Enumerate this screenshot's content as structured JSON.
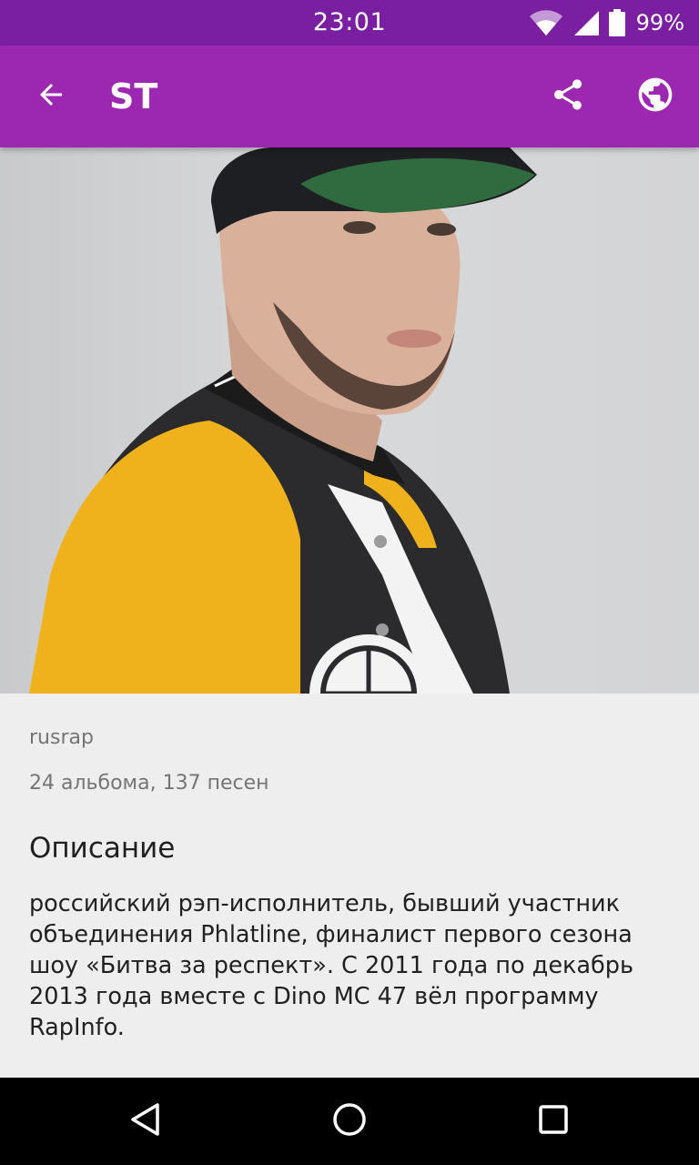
{
  "status_bar": {
    "time": "23:01",
    "battery": "99%",
    "icons": [
      "wifi-icon",
      "signal-icon",
      "battery-icon"
    ]
  },
  "app_bar": {
    "title": "ST",
    "icons": [
      "back-arrow-icon",
      "share-icon",
      "globe-icon"
    ]
  },
  "artist": {
    "genre": "rusrap",
    "counts": "24 альбома, 137 песен",
    "description_heading": "Описание",
    "description": "российский рэп-исполнитель, бывший участник объединения Phlatline, финалист первого сезона шоу «Битва за респект». С 2011 года по декабрь 2013 года вместе с Dino MC 47 вёл программу RapInfo."
  },
  "nav_bar": {
    "icons": [
      "back-triangle-icon",
      "home-circle-icon",
      "recents-square-icon"
    ]
  },
  "colors": {
    "status_bar": "#7b1fa2",
    "app_bar": "#9c27b0",
    "background": "#eeeeee",
    "nav_bar": "#000000"
  }
}
